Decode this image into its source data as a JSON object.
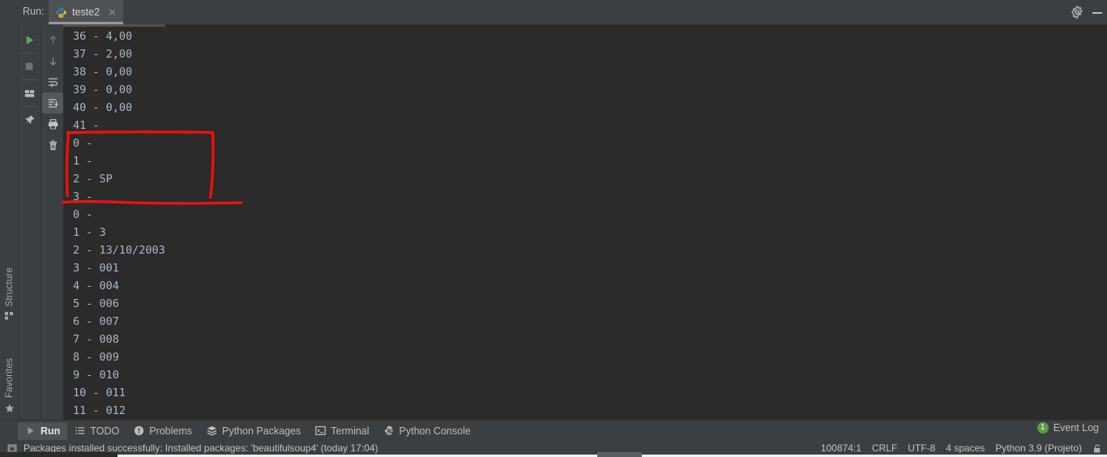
{
  "window": {
    "run_label": "Run:",
    "settings_icon": "gear-icon",
    "minimize_icon": "minimize-icon"
  },
  "run_tab": {
    "icon": "python-file-icon",
    "title": "teste2",
    "close_icon": "close-icon"
  },
  "left_rail": [
    {
      "label": "Structure",
      "icon": "structure-grid-icon"
    },
    {
      "label": "Favorites",
      "icon": "star-icon"
    }
  ],
  "toolbar_left": [
    {
      "name": "rerun-button",
      "icon": "run-play-icon"
    },
    {
      "name": "stop-button",
      "icon": "stop-square-icon"
    },
    {
      "name": "layout-button",
      "icon": "layout-icon"
    },
    {
      "name": "pin-tab-button",
      "icon": "pin-icon"
    }
  ],
  "toolbar_right": [
    {
      "name": "up-stack-trace-button",
      "icon": "arrow-up-icon"
    },
    {
      "name": "down-stack-trace-button",
      "icon": "arrow-down-icon"
    },
    {
      "name": "soft-wrap-button",
      "icon": "soft-wrap-icon"
    },
    {
      "name": "scroll-to-end-button",
      "icon": "scroll-to-end-icon",
      "selected": true
    },
    {
      "name": "print-button",
      "icon": "printer-icon"
    },
    {
      "name": "clear-all-button",
      "icon": "trash-icon"
    }
  ],
  "console": {
    "lines": [
      "36 - 4,00",
      "37 - 2,00",
      "38 - 0,00",
      "39 - 0,00",
      "40 - 0,00",
      "41 -",
      "0 -",
      "1 -",
      "2 - SP",
      "3 -",
      "0 -",
      "1 - 3",
      "2 - 13/10/2003",
      "3 - 001",
      "4 - 004",
      "5 - 006",
      "6 - 007",
      "7 - 008",
      "8 - 009",
      "9 - 010",
      "10 - 011",
      "11 - 012"
    ]
  },
  "annotation": {
    "color": "#ee1111",
    "shape": "hand-drawn-rectangle-with-underline",
    "encloses_lines": [
      "0 -",
      "1 -",
      "2 - SP",
      "3 -"
    ]
  },
  "bottom_tabs": [
    {
      "label": "Run",
      "icon": "run-play-icon",
      "active": true
    },
    {
      "label": "TODO",
      "icon": "list-icon",
      "active": false
    },
    {
      "label": "Problems",
      "icon": "problems-warning-icon",
      "active": false
    },
    {
      "label": "Python Packages",
      "icon": "packages-layers-icon",
      "active": false
    },
    {
      "label": "Terminal",
      "icon": "terminal-icon",
      "active": false
    },
    {
      "label": "Python Console",
      "icon": "python-console-icon",
      "active": false
    }
  ],
  "event_log": {
    "label": "Event Log",
    "count": "1",
    "badge_color": "#5a9c44"
  },
  "status": {
    "message_icon": "notification-icon",
    "message": "Packages installed successfully: Installed packages: 'beautifulsoup4' (today 17:04)",
    "caret": "100874:1",
    "line_separator": "CRLF",
    "encoding": "UTF-8",
    "indent": "4 spaces",
    "interpreter": "Python 3.9 (Projeto)",
    "lock_icon": "unlocked-padlock-icon"
  }
}
